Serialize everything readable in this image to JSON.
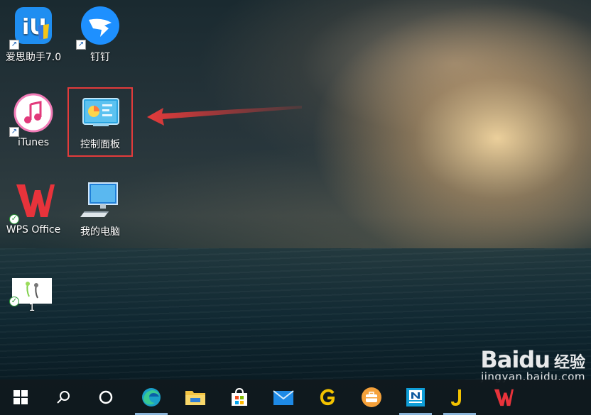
{
  "desktop": {
    "icons": [
      {
        "label": "爱思助手7.0",
        "icon": "i4-icon",
        "badge": "shortcut"
      },
      {
        "label": "钉钉",
        "icon": "dingtalk-icon",
        "badge": "shortcut"
      },
      {
        "label": "iTunes",
        "icon": "itunes-icon",
        "badge": "shortcut"
      },
      {
        "label": "控制面板",
        "icon": "control-panel-icon",
        "badge": "",
        "highlighted": true
      },
      {
        "label": "WPS Office",
        "icon": "wps-icon",
        "badge": "sync-check"
      },
      {
        "label": "我的电脑",
        "icon": "computer-icon",
        "badge": ""
      },
      {
        "label": "1",
        "icon": "image-file-icon",
        "badge": "sync-check"
      }
    ],
    "annotation": {
      "arrow_color": "#e43b3b",
      "box_color": "#e43b3b"
    }
  },
  "taskbar": {
    "items": [
      {
        "name": "start",
        "icon": "windows-icon"
      },
      {
        "name": "search",
        "icon": "search-icon"
      },
      {
        "name": "cortana",
        "icon": "cortana-icon"
      },
      {
        "name": "edge",
        "icon": "edge-icon",
        "active": true
      },
      {
        "name": "file-explorer",
        "icon": "folder-icon"
      },
      {
        "name": "store",
        "icon": "store-icon"
      },
      {
        "name": "mail",
        "icon": "mail-icon"
      },
      {
        "name": "app-g",
        "icon": "g-app-icon"
      },
      {
        "name": "briefcase",
        "icon": "briefcase-icon"
      },
      {
        "name": "news",
        "icon": "news-icon",
        "active": true
      },
      {
        "name": "app-yellow",
        "icon": "yellow-app-icon",
        "active": true
      },
      {
        "name": "wps",
        "icon": "wps-icon"
      }
    ]
  },
  "watermark": {
    "brand": "Baidu",
    "suffix": "经验",
    "url": "jingyan.baidu.com"
  }
}
